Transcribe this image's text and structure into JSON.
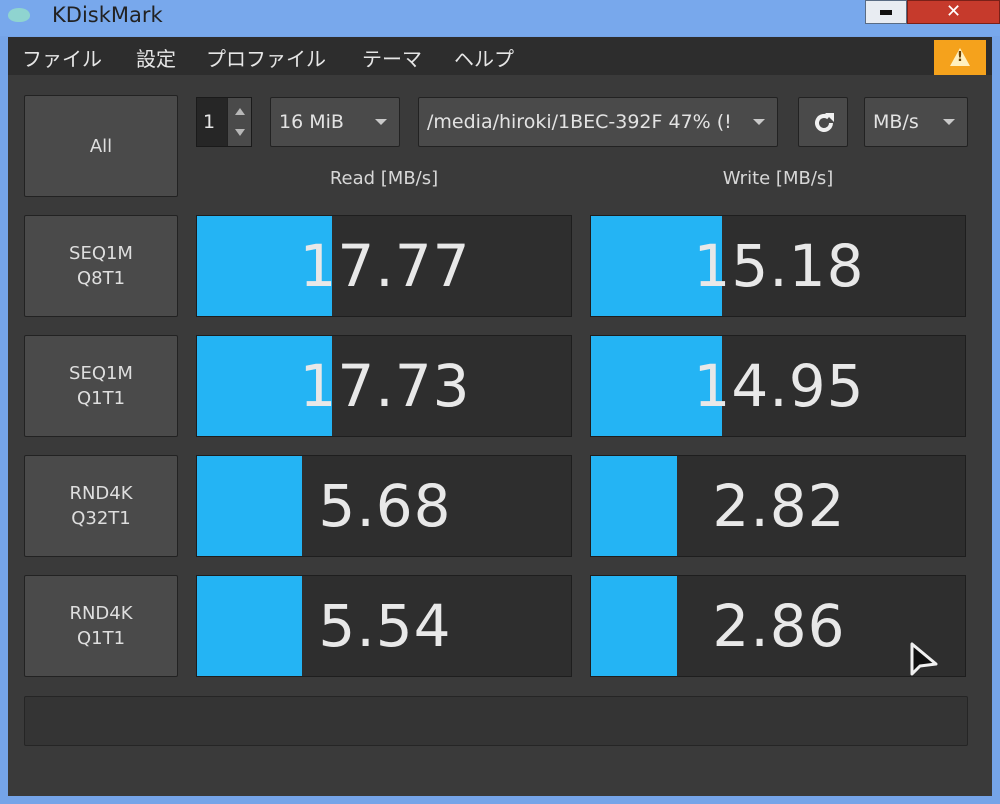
{
  "window": {
    "title": "KDiskMark",
    "close_glyph": "✕",
    "icons": {
      "minimize": "minimize-icon",
      "close": "close-icon",
      "app": "app-icon"
    }
  },
  "menu": [
    "ファイル",
    "設定",
    "プロファイル",
    "テーマ",
    "ヘルプ"
  ],
  "warning": {
    "icon": "warning-icon",
    "mark": "!",
    "color": "#f5a21c"
  },
  "toolbar": {
    "all_label": "All",
    "runs": "1",
    "size": "16 MiB",
    "device": "/media/hiroki/1BEC-392F 47% (!",
    "unit": "MB/s",
    "refresh_icon": "refresh-icon"
  },
  "columns": {
    "read": "Read [MB/s]",
    "write": "Write [MB/s]"
  },
  "rows": [
    {
      "line1": "SEQ1M",
      "line2": "Q8T1",
      "read": "17.77",
      "write": "15.18",
      "read_fill": 0.36,
      "write_fill": 0.35
    },
    {
      "line1": "SEQ1M",
      "line2": "Q1T1",
      "read": "17.73",
      "write": "14.95",
      "read_fill": 0.36,
      "write_fill": 0.35
    },
    {
      "line1": "RND4K",
      "line2": "Q32T1",
      "read": "5.68",
      "write": "2.82",
      "read_fill": 0.28,
      "write_fill": 0.23
    },
    {
      "line1": "RND4K",
      "line2": "Q1T1",
      "read": "5.54",
      "write": "2.86",
      "read_fill": 0.28,
      "write_fill": 0.23
    }
  ],
  "colors": {
    "bar": "#24b4f4",
    "background": "#3a3a3a"
  }
}
